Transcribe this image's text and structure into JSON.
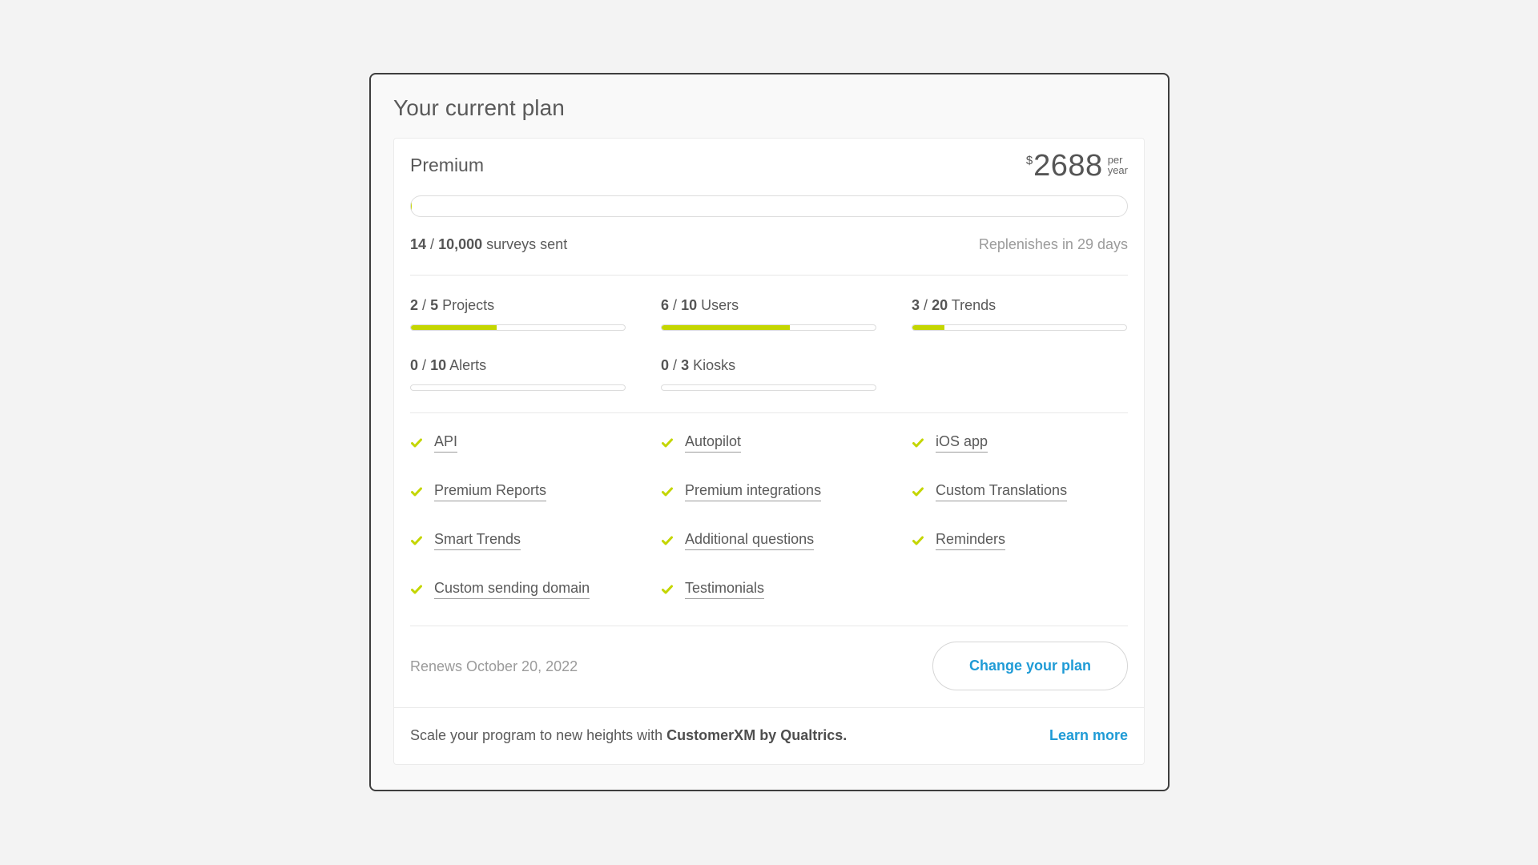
{
  "title": "Your current plan",
  "plan": {
    "name": "Premium",
    "price_currency": "$",
    "price_amount": "2688",
    "price_period_line1": "per",
    "price_period_line2": "year"
  },
  "surveys": {
    "used": "14",
    "separator": "/",
    "limit": "10,000",
    "label": "surveys sent",
    "progress_fraction": 0.0014,
    "replenish_text": "Replenishes in 29 days"
  },
  "usage": [
    {
      "used": "2",
      "limit": "5",
      "label": "Projects",
      "fraction": 0.4
    },
    {
      "used": "6",
      "limit": "10",
      "label": "Users",
      "fraction": 0.6
    },
    {
      "used": "3",
      "limit": "20",
      "label": "Trends",
      "fraction": 0.15
    },
    {
      "used": "0",
      "limit": "10",
      "label": "Alerts",
      "fraction": 0
    },
    {
      "used": "0",
      "limit": "3",
      "label": "Kiosks",
      "fraction": 0
    }
  ],
  "features": [
    "API",
    "Autopilot",
    "iOS app",
    "Premium Reports",
    "Premium integrations",
    "Custom Translations",
    "Smart Trends",
    "Additional questions",
    "Reminders",
    "Custom sending domain",
    "Testimonials"
  ],
  "colors": {
    "accent_green": "#c4d600",
    "link_blue": "#1f9bd6"
  },
  "footer": {
    "renews": "Renews October 20, 2022",
    "change_plan_label": "Change your plan",
    "promo_prefix": "Scale your program to new heights with ",
    "promo_brand": "CustomerXM by Qualtrics.",
    "learn_more_label": "Learn more"
  }
}
